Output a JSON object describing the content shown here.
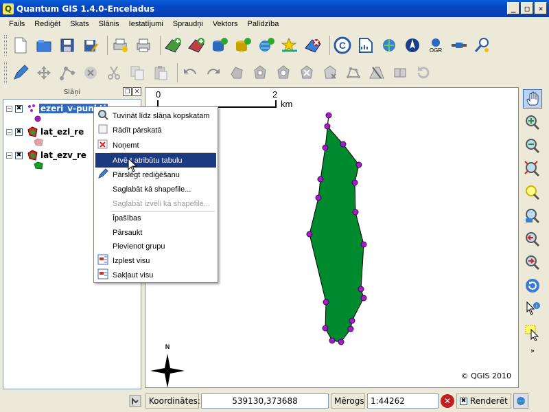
{
  "window": {
    "title": "Quantum GIS 1.4.0-Enceladus",
    "app_icon_glyph": "Q",
    "buttons": [
      "_",
      "□",
      "✕"
    ]
  },
  "menubar": {
    "items": [
      "Fails",
      "Rediģēt",
      "Skats",
      "Slānis",
      "Iestatījumi",
      "Spraudņi",
      "Vektors",
      "Palīdzība"
    ]
  },
  "layers_panel": {
    "title": "Slāņi",
    "layers": [
      {
        "name": "ezeri_v-punkti",
        "checked": "✖"
      },
      {
        "name": "lat_ezl_re",
        "checked": "✖"
      },
      {
        "name": "lat_ezv_re",
        "checked": "✖"
      }
    ]
  },
  "context_menu": {
    "items": [
      {
        "label": "Tuvināt līdz slāņa kopskatam",
        "icon": "zoom-icon",
        "state": "normal"
      },
      {
        "label": "Rādīt pārskatā",
        "icon": "checkbox-icon",
        "state": "normal"
      },
      {
        "label": "Noņemt",
        "icon": "remove-icon",
        "state": "normal"
      },
      {
        "label": "Atvērt atribūtu tabulu",
        "icon": "",
        "state": "highlighted"
      },
      {
        "label": "Pārslēgt rediģēšanu",
        "icon": "pencil-icon",
        "state": "normal"
      },
      {
        "label": "Saglabāt kā shapefile...",
        "icon": "",
        "state": "normal"
      },
      {
        "label": "Saglabāt izvēli kā shapefile...",
        "icon": "",
        "state": "disabled"
      },
      {
        "label": "Īpašības",
        "icon": "",
        "state": "normal"
      },
      {
        "label": "Pārsaukt",
        "icon": "",
        "state": "normal"
      },
      {
        "label": "Pievienot grupu",
        "icon": "",
        "state": "normal"
      },
      {
        "label": "Izplest visu",
        "icon": "expand-icon",
        "state": "normal"
      },
      {
        "label": "Sakļaut visu",
        "icon": "collapse-icon",
        "state": "normal"
      }
    ]
  },
  "map": {
    "scalebar": {
      "start": "0",
      "end": "2",
      "unit": "km"
    },
    "north_arrow": "N",
    "copyright": "© QGIS 2010",
    "polygon_fill": "#008a2e",
    "vertex_color": "#a020c0"
  },
  "statusbar": {
    "coords_label": "Koordinātes:",
    "coords_value": "539130,373688",
    "scale_label": "Mērogs",
    "scale_value": "1:44262",
    "render_label": "Renderēt",
    "render_checked": "✖"
  }
}
